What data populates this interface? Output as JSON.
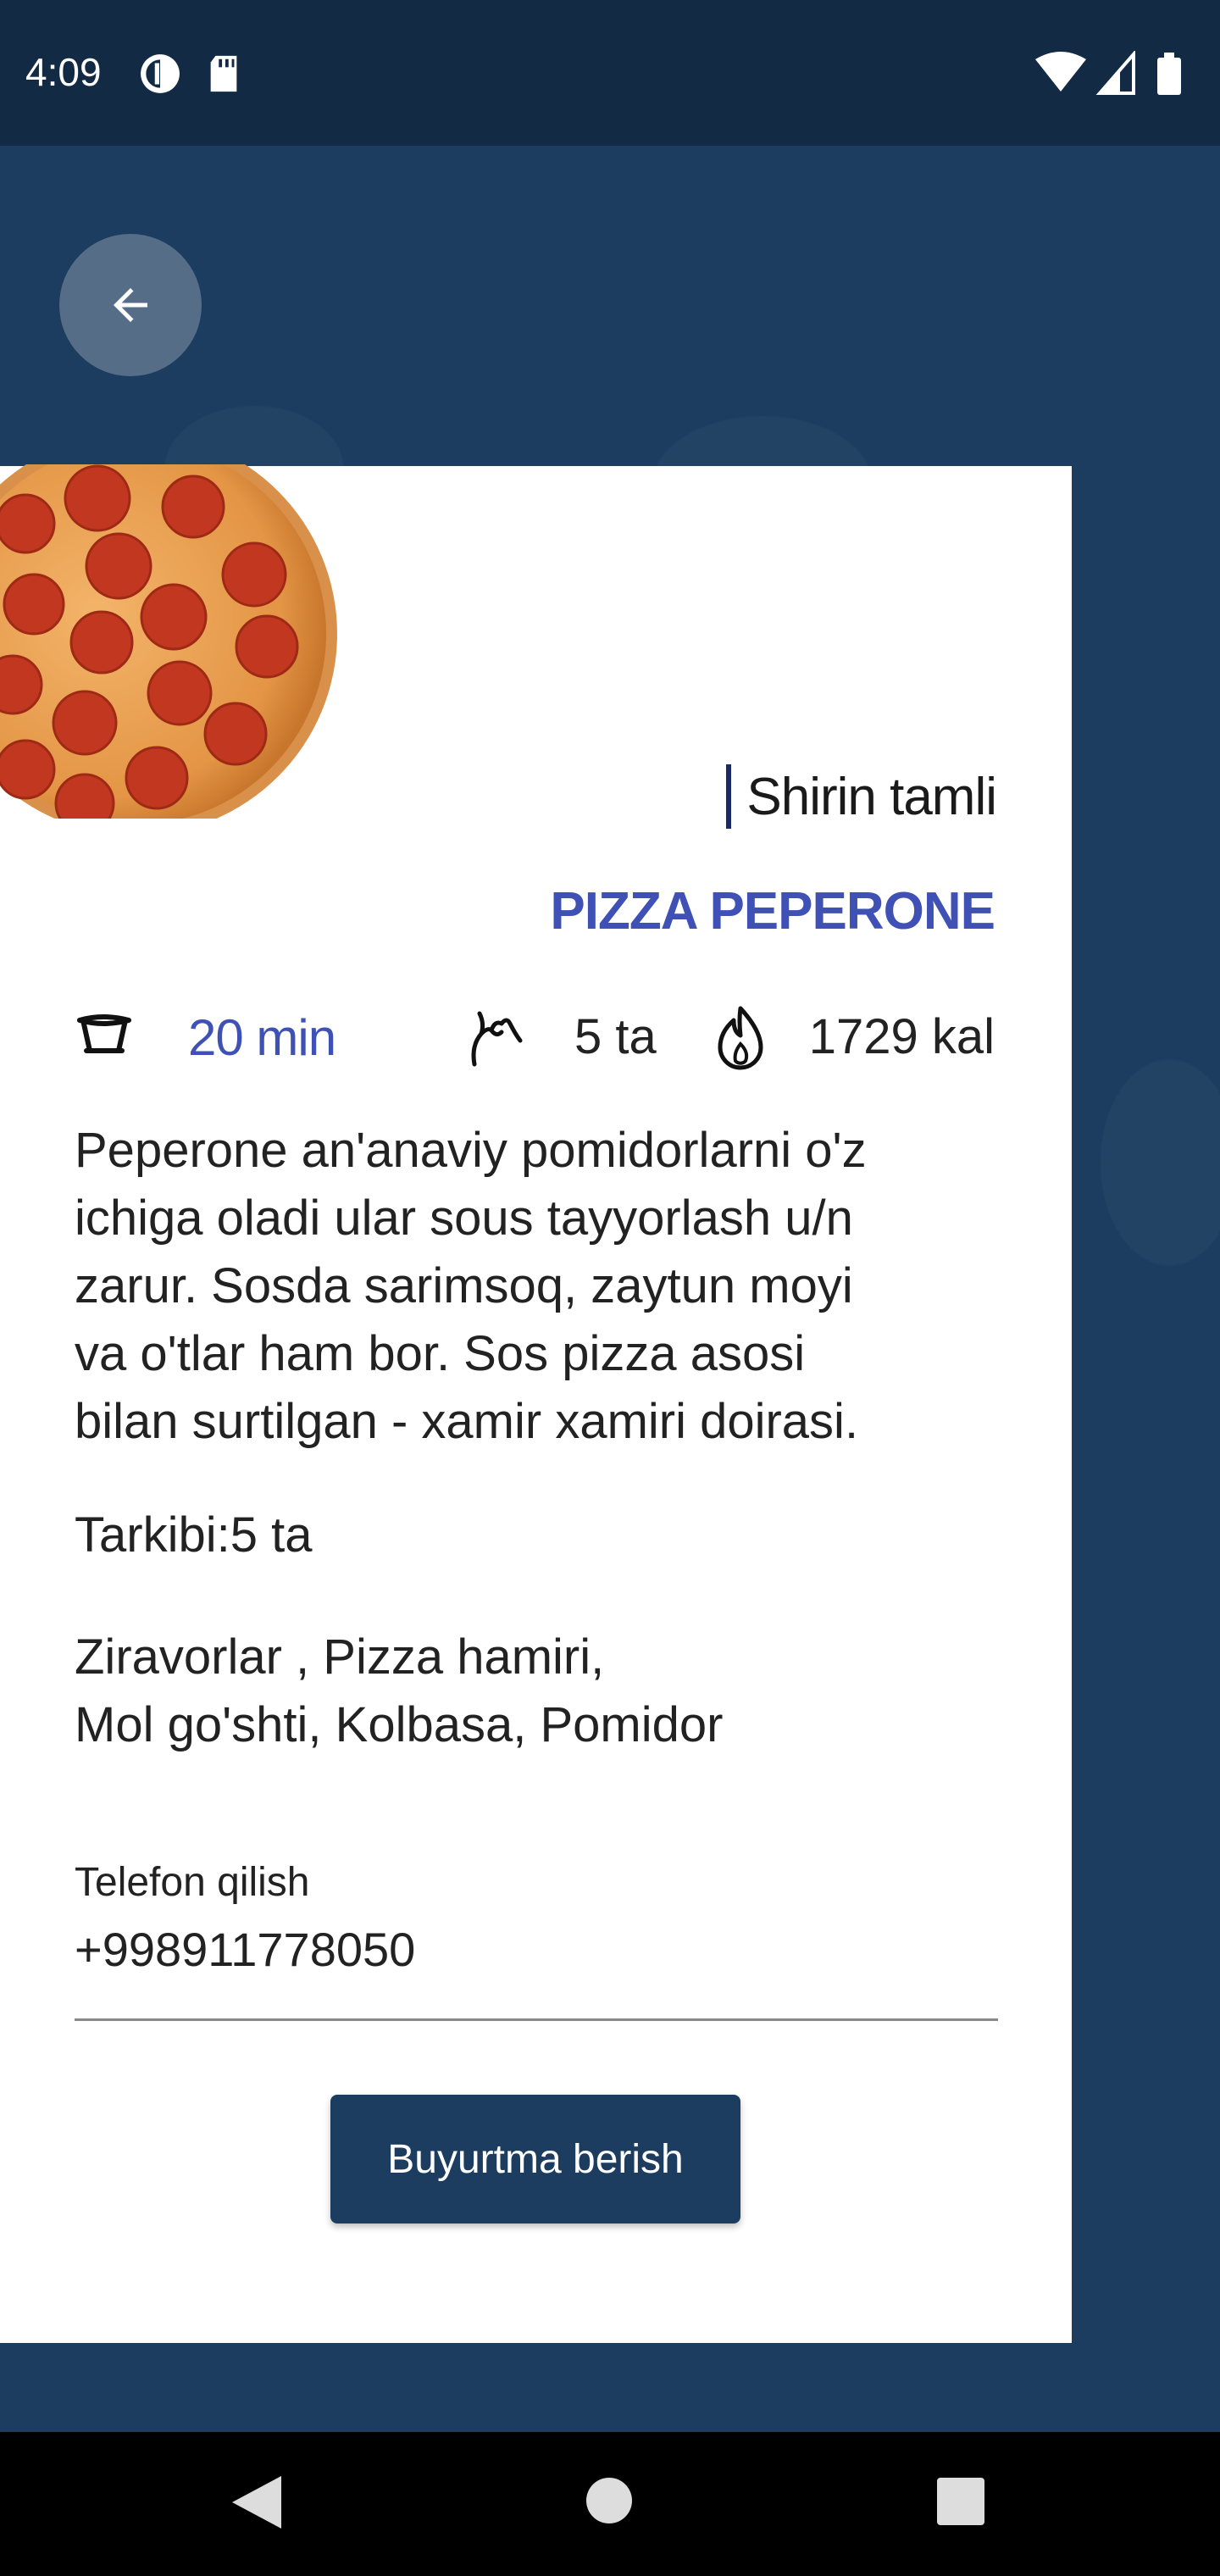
{
  "status_bar": {
    "time": "4:09"
  },
  "header": {
    "back_icon": "arrow-left-icon"
  },
  "product": {
    "subtitle": "Shirin tamli",
    "title": "PIZZA PEPERONE",
    "time": "20 min",
    "count": "5 ta",
    "calories": "1729 kal",
    "description_lines": [
      "Peperone an'anaviy pomidorlarni o'z",
      "ichiga oladi ular sous tayyorlash u/n",
      "zarur. Sosda sarimsoq, zaytun moyi",
      "va o'tlar ham bor. Sos pizza asosi",
      "bilan surtilgan - xamir xamiri doirasi."
    ],
    "ingredient_count": "Tarkibi:5 ta",
    "ingredients_lines": [
      "Ziravorlar , Pizza hamiri,",
      "Mol go'shti, Kolbasa, Pomidor"
    ]
  },
  "phone": {
    "label": "Telefon qilish",
    "value": "+998911778050"
  },
  "order_button": {
    "label": "Buyurtma berish"
  },
  "colors": {
    "accent": "#3f51b5",
    "primary": "#1c3d5f",
    "status_bar": "#132a45"
  }
}
